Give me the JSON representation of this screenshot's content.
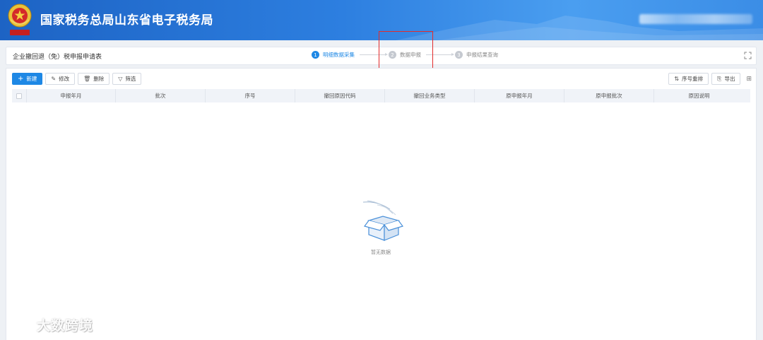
{
  "header": {
    "site_title": "国家税务总局山东省电子税务局",
    "emblem_icon": "tax-emblem-icon"
  },
  "form": {
    "title": "企业撤回退（免）税申报申请表",
    "steps": [
      {
        "num": "1",
        "label": "明细数据采集",
        "active": true
      },
      {
        "num": "2",
        "label": "数据申报",
        "active": false
      },
      {
        "num": "3",
        "label": "申报结果查询",
        "active": false
      }
    ]
  },
  "toolbar": {
    "new_label": "新建",
    "edit_label": "修改",
    "delete_label": "删除",
    "filter_label": "筛选",
    "reorder_label": "序号重排",
    "export_label": "导出"
  },
  "table": {
    "columns": [
      "申报年月",
      "批次",
      "序号",
      "撤回原因代码",
      "撤回业务类型",
      "原申报年月",
      "原申报批次",
      "原因说明"
    ],
    "rows": [],
    "empty_text": "暂无数据"
  },
  "watermark": {
    "text": "大数跨境"
  },
  "colors": {
    "primary": "#1e88e5",
    "header": "#2d7fe0",
    "highlight": "#e32b2b"
  }
}
